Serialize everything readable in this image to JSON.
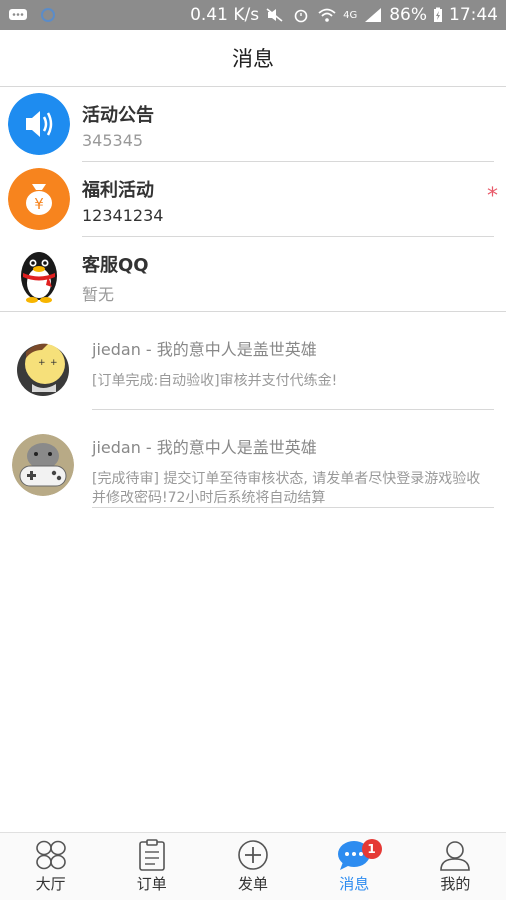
{
  "statusbar": {
    "speed": "0.41 K/s",
    "network": "4G",
    "battery": "86%",
    "time": "17:44"
  },
  "header": {
    "title": "消息"
  },
  "system_items": [
    {
      "name": "活动公告",
      "desc": "345345",
      "icon": "speaker-icon",
      "color": "#1e8cf0"
    },
    {
      "name": "福利活动",
      "desc": "12341234",
      "icon": "money-bag-icon",
      "color": "#f7841e",
      "flag": "*"
    },
    {
      "name": "客服QQ",
      "desc": "暂无",
      "icon": "qq-penguin-icon"
    }
  ],
  "chats": [
    {
      "name": "jiedan - 我的意中人是盖世英雄",
      "msg": "[订单完成:自动验收]审核并支付代练金!"
    },
    {
      "name": "jiedan - 我的意中人是盖世英雄",
      "msg": "[完成待审] 提交订单至待审核状态, 请发单者尽快登录游戏验收并修改密码!72小时后系统将自动结算"
    }
  ],
  "tabs": [
    {
      "label": "大厅",
      "icon": "grid-icon"
    },
    {
      "label": "订单",
      "icon": "clipboard-icon"
    },
    {
      "label": "发单",
      "icon": "plus-circle-icon"
    },
    {
      "label": "消息",
      "icon": "chat-bubble-icon",
      "badge": "1",
      "active": true
    },
    {
      "label": "我的",
      "icon": "user-icon"
    }
  ],
  "colors": {
    "accent": "#2d8cf0",
    "badge": "#e53935"
  }
}
